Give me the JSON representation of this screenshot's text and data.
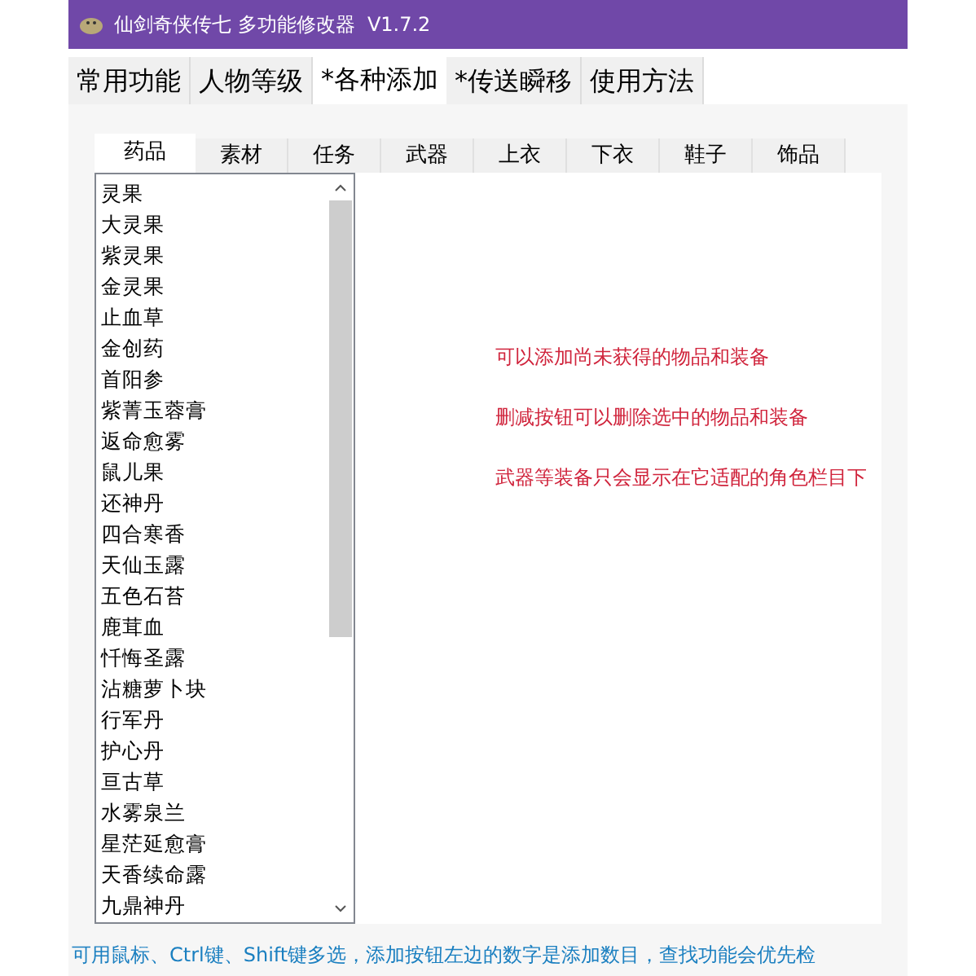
{
  "window": {
    "title": "仙剑奇侠传七 多功能修改器  V1.7.2"
  },
  "tabs": [
    {
      "label": "常用功能",
      "selected": false
    },
    {
      "label": "人物等级",
      "selected": false
    },
    {
      "label": "*各种添加",
      "selected": true
    },
    {
      "label": "*传送瞬移",
      "selected": false
    },
    {
      "label": "使用方法",
      "selected": false
    }
  ],
  "sub_tabs": [
    {
      "label": "药品",
      "selected": true
    },
    {
      "label": "素材",
      "selected": false
    },
    {
      "label": "任务",
      "selected": false
    },
    {
      "label": "武器",
      "selected": false
    },
    {
      "label": "上衣",
      "selected": false
    },
    {
      "label": "下衣",
      "selected": false
    },
    {
      "label": "鞋子",
      "selected": false
    },
    {
      "label": "饰品",
      "selected": false
    }
  ],
  "item_list": [
    "灵果",
    "大灵果",
    "紫灵果",
    "金灵果",
    "止血草",
    "金创药",
    "首阳参",
    "紫菁玉蓉膏",
    "返命愈雾",
    "鼠儿果",
    "还神丹",
    "四合寒香",
    "天仙玉露",
    "五色石苔",
    "鹿茸血",
    "忏悔圣露",
    "沾糖萝卜块",
    "行军丹",
    "护心丹",
    "亘古草",
    "水雾泉兰",
    "星茫延愈膏",
    "天香续命露",
    "九鼎神丹"
  ],
  "hints": [
    "可以添加尚未获得的物品和装备",
    "删减按钮可以删除选中的物品和装备",
    "武器等装备只会显示在它适配的角色栏目下"
  ],
  "status_bar": "可用鼠标、Ctrl键、Shift键多选，添加按钮左边的数字是添加数目，查找功能会优先检"
}
